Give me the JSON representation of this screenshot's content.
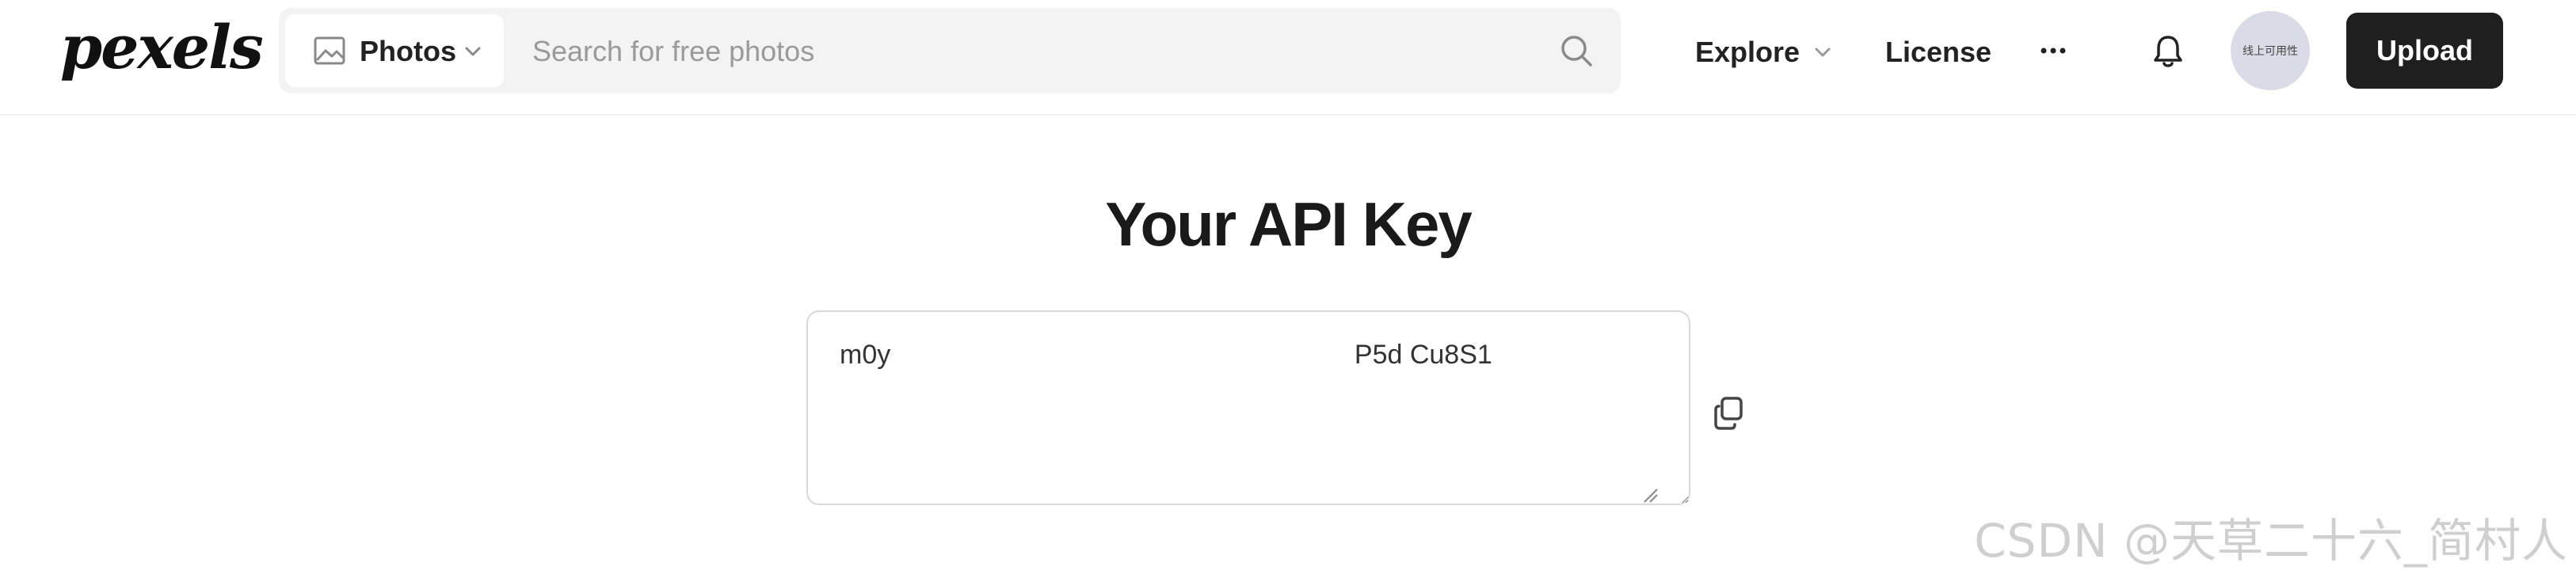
{
  "header": {
    "logo_text": "pexels",
    "search": {
      "type_label": "Photos",
      "placeholder": "Search for free photos",
      "value": ""
    },
    "nav": {
      "explore_label": "Explore",
      "license_label": "License",
      "more_label": "···"
    },
    "avatar_text": "线上可用性",
    "upload_label": "Upload"
  },
  "main": {
    "title": "Your API Key",
    "api_key_value": "m0y                                                              P5d Cu8S1"
  },
  "watermark": "CSDN @天草二十六_简村人",
  "icons": [
    "image-icon",
    "chevron-down-icon",
    "search-icon",
    "more-icon",
    "bell-icon",
    "copy-icon"
  ]
}
